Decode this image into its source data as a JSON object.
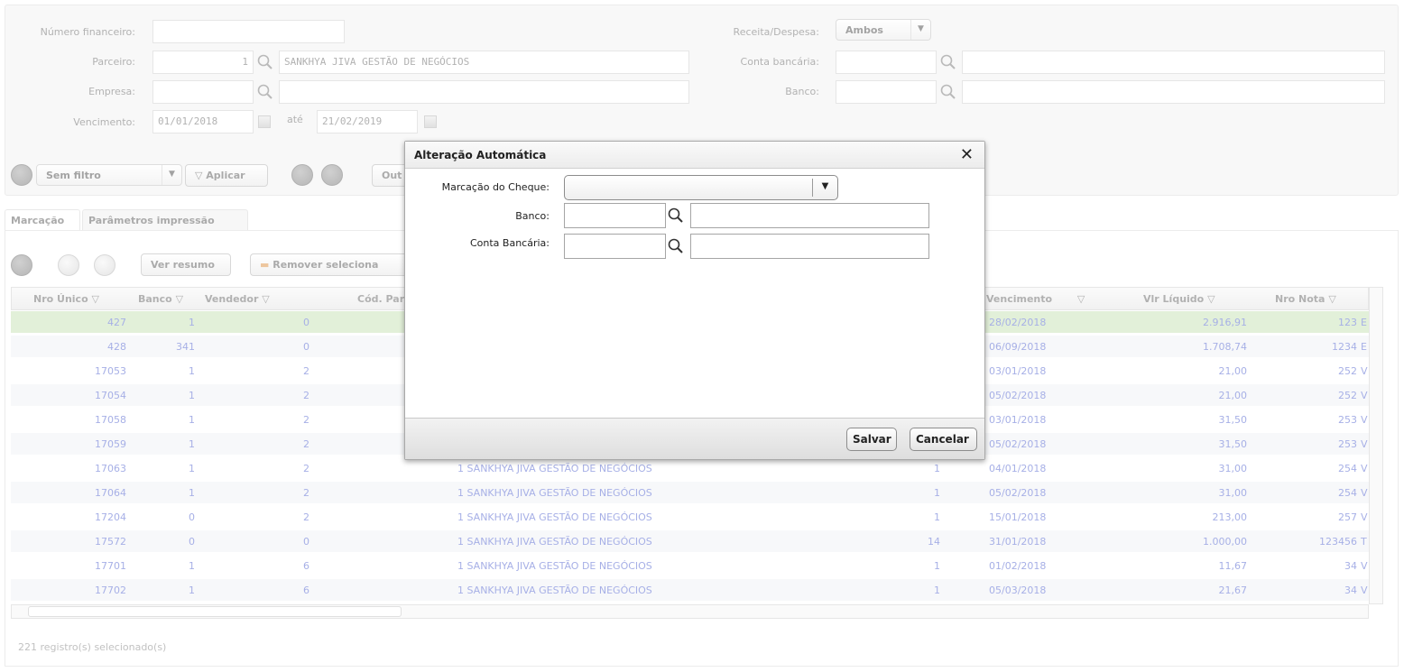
{
  "filters": {
    "numero_financeiro_label": "Número financeiro:",
    "parceiro_label": "Parceiro:",
    "parceiro_code": "1",
    "parceiro_name": "SANKHYA JIVA GESTÃO DE NEGÓCIOS",
    "empresa_label": "Empresa:",
    "vencimento_label": "Vencimento:",
    "vencimento_from": "01/01/2018",
    "ate_label": "até",
    "vencimento_to": "21/02/2019",
    "receita_label": "Receita/Despesa:",
    "receita_value": "Ambos",
    "conta_label": "Conta bancária:",
    "banco_label": "Banco:"
  },
  "toolbar": {
    "sem_filtro": "Sem filtro",
    "aplicar": "Aplicar",
    "outros": "Out"
  },
  "tabs": [
    "Marcação",
    "Parâmetros impressão"
  ],
  "actions": {
    "ver_resumo": "Ver resumo",
    "remover": "Remover seleciona"
  },
  "grid": {
    "headers": [
      "Nro Único",
      "Banco",
      "Vendedor",
      "Cód. Par",
      "Vencimento",
      "Vlr Líquido",
      "Nro Nota"
    ],
    "rows": [
      {
        "nro": "427",
        "banco": "1",
        "vend": "0",
        "parc": "",
        "qtd": "",
        "venc": "28/02/2018",
        "vlr": "2.916,91",
        "nota": "123",
        "extra": "E"
      },
      {
        "nro": "428",
        "banco": "341",
        "vend": "0",
        "parc": "",
        "qtd": "",
        "venc": "06/09/2018",
        "vlr": "1.708,74",
        "nota": "1234",
        "extra": "E"
      },
      {
        "nro": "17053",
        "banco": "1",
        "vend": "2",
        "parc": "",
        "qtd": "",
        "venc": "03/01/2018",
        "vlr": "21,00",
        "nota": "252",
        "extra": "V"
      },
      {
        "nro": "17054",
        "banco": "1",
        "vend": "2",
        "parc": "",
        "qtd": "",
        "venc": "05/02/2018",
        "vlr": "21,00",
        "nota": "252",
        "extra": "V"
      },
      {
        "nro": "17058",
        "banco": "1",
        "vend": "2",
        "parc": "",
        "qtd": "",
        "venc": "03/01/2018",
        "vlr": "31,50",
        "nota": "253",
        "extra": "V"
      },
      {
        "nro": "17059",
        "banco": "1",
        "vend": "2",
        "parc": "",
        "qtd": "",
        "venc": "05/02/2018",
        "vlr": "31,50",
        "nota": "253",
        "extra": "V"
      },
      {
        "nro": "17063",
        "banco": "1",
        "vend": "2",
        "parc": "1 SANKHYA JIVA GESTÃO DE NEGÓCIOS",
        "qtd": "1",
        "venc": "04/01/2018",
        "vlr": "31,00",
        "nota": "254",
        "extra": "V"
      },
      {
        "nro": "17064",
        "banco": "1",
        "vend": "2",
        "parc": "1 SANKHYA JIVA GESTÃO DE NEGÓCIOS",
        "qtd": "1",
        "venc": "05/02/2018",
        "vlr": "31,00",
        "nota": "254",
        "extra": "V"
      },
      {
        "nro": "17204",
        "banco": "0",
        "vend": "2",
        "parc": "1 SANKHYA JIVA GESTÃO DE NEGÓCIOS",
        "qtd": "1",
        "venc": "15/01/2018",
        "vlr": "213,00",
        "nota": "257",
        "extra": "V"
      },
      {
        "nro": "17572",
        "banco": "0",
        "vend": "0",
        "parc": "1 SANKHYA JIVA GESTÃO DE NEGÓCIOS",
        "qtd": "14",
        "venc": "31/01/2018",
        "vlr": "1.000,00",
        "nota": "123456",
        "extra": "T"
      },
      {
        "nro": "17701",
        "banco": "1",
        "vend": "6",
        "parc": "1 SANKHYA JIVA GESTÃO DE NEGÓCIOS",
        "qtd": "1",
        "venc": "01/02/2018",
        "vlr": "11,67",
        "nota": "34",
        "extra": "V"
      },
      {
        "nro": "17702",
        "banco": "1",
        "vend": "6",
        "parc": "1 SANKHYA JIVA GESTÃO DE NEGÓCIOS",
        "qtd": "1",
        "venc": "05/03/2018",
        "vlr": "21,67",
        "nota": "34",
        "extra": "V"
      }
    ]
  },
  "status": "221 registro(s) selecionado(s)",
  "modal": {
    "title": "Alteração Automática",
    "close": "✕",
    "marcacao_label": "Marcação do Cheque:",
    "marcacao_value": "",
    "banco_label": "Banco:",
    "conta_label": "Conta Bancária:",
    "salvar": "Salvar",
    "cancelar": "Cancelar"
  },
  "colors": {
    "selected_row": "#bfe0ad",
    "link_text": "#3b4fc9"
  }
}
